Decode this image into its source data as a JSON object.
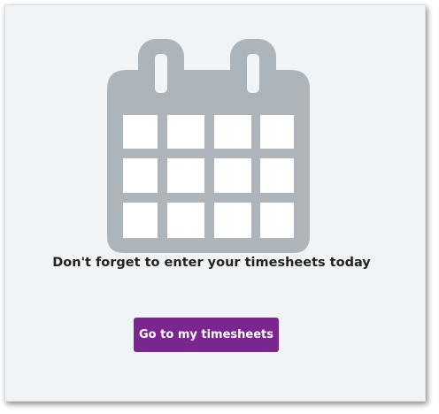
{
  "icons": {
    "calendar": "calendar-icon",
    "calendar_color": "#aeb5ba"
  },
  "reminder": {
    "message": "Don't forget to enter your timesheets today"
  },
  "actions": {
    "go_label": "Go to my timesheets",
    "button_color": "#7a2590"
  }
}
